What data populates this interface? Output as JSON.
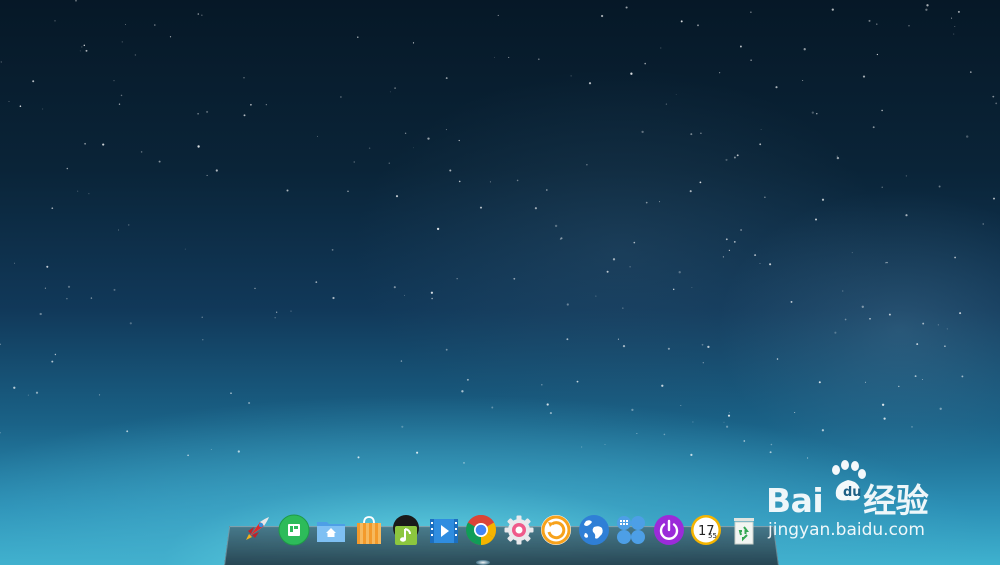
{
  "desktop": {
    "wallpaper": "starry-night-sky",
    "colors": {
      "top": "#061827",
      "mid": "#11395a",
      "horizon": "#3fb2cf"
    }
  },
  "dock": {
    "items": [
      {
        "name": "launcher",
        "icon": "rocket-icon"
      },
      {
        "name": "deepin-store-app",
        "icon": "app-store-icon"
      },
      {
        "name": "file-manager",
        "icon": "home-folder-icon"
      },
      {
        "name": "app-store",
        "icon": "shopping-bag-icon"
      },
      {
        "name": "music-player",
        "icon": "music-icon"
      },
      {
        "name": "video-player",
        "icon": "film-play-icon"
      },
      {
        "name": "chrome-browser",
        "icon": "chrome-icon"
      },
      {
        "name": "settings",
        "icon": "gear-icon"
      },
      {
        "name": "screen-recorder",
        "icon": "refresh-circle-icon"
      },
      {
        "name": "web-browser",
        "icon": "globe-icon"
      },
      {
        "name": "multitasking-view",
        "icon": "grid-dots-icon"
      },
      {
        "name": "shutdown",
        "icon": "power-icon"
      },
      {
        "name": "clock",
        "icon": "clock-icon"
      },
      {
        "name": "trash",
        "icon": "trash-icon"
      }
    ],
    "clock_hour": "17",
    "clock_minute": "55",
    "active_item": "chrome-browser"
  },
  "watermark": {
    "logo_text": "Bai",
    "logo_text_2": "经验",
    "url": "jingyan.baidu.com"
  }
}
